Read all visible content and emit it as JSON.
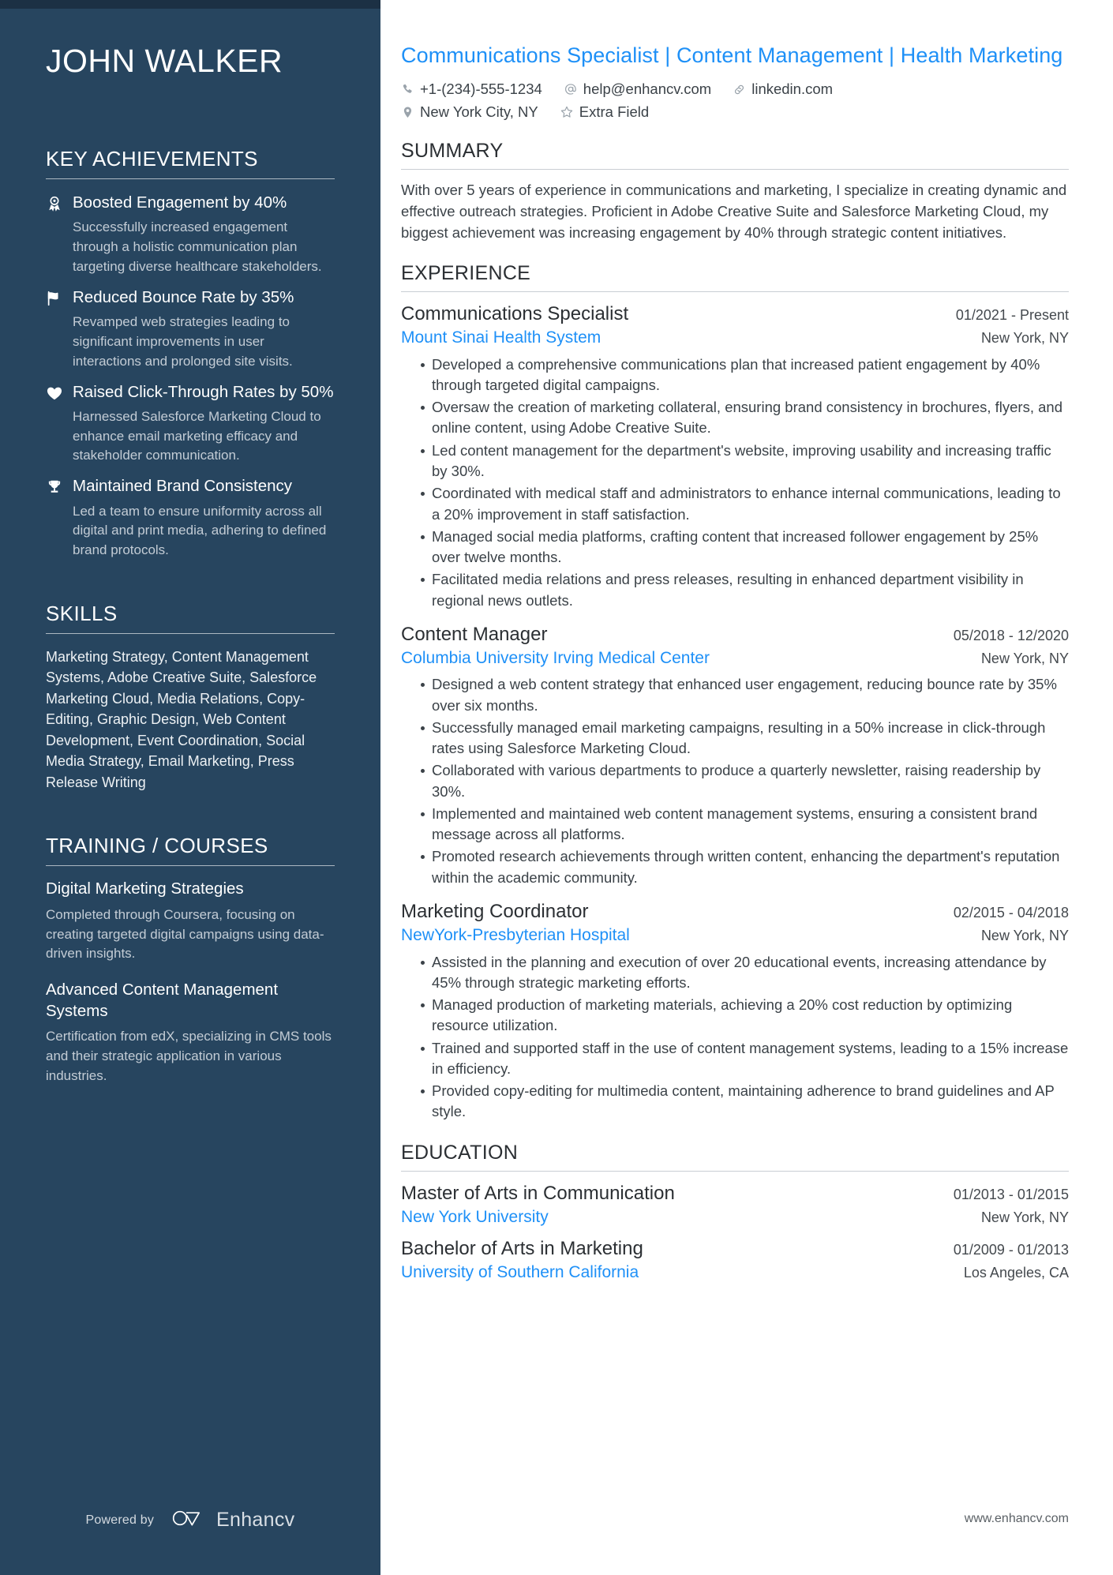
{
  "sidebar": {
    "name": "JOHN WALKER",
    "key_achievements_title": "KEY ACHIEVEMENTS",
    "achievements": [
      {
        "icon": "award-ribbon-icon",
        "title": "Boosted Engagement by 40%",
        "description": "Successfully increased engagement through a holistic communication plan targeting diverse healthcare stakeholders."
      },
      {
        "icon": "flag-icon",
        "title": "Reduced Bounce Rate by 35%",
        "description": "Revamped web strategies leading to significant improvements in user interactions and prolonged site visits."
      },
      {
        "icon": "heart-icon",
        "title": "Raised Click-Through Rates by 50%",
        "description": "Harnessed Salesforce Marketing Cloud to enhance email marketing efficacy and stakeholder communication."
      },
      {
        "icon": "trophy-icon",
        "title": "Maintained Brand Consistency",
        "description": "Led a team to ensure uniformity across all digital and print media, adhering to defined brand protocols."
      }
    ],
    "skills_title": "SKILLS",
    "skills_text": "Marketing Strategy, Content Management Systems, Adobe Creative Suite, Salesforce Marketing Cloud, Media Relations, Copy-Editing, Graphic Design, Web Content Development, Event Coordination, Social Media Strategy, Email Marketing, Press Release Writing",
    "training_title": "TRAINING / COURSES",
    "courses": [
      {
        "title": "Digital Marketing Strategies",
        "description": "Completed through Coursera, focusing on creating targeted digital campaigns using data-driven insights."
      },
      {
        "title": "Advanced Content Management Systems",
        "description": "Certification from edX, specializing in CMS tools and their strategic application in various industries."
      }
    ],
    "footer": {
      "powered_by": "Powered by",
      "brand": "Enhancv",
      "brand_icon": "enhancv-logo-icon"
    }
  },
  "main": {
    "headline": "Communications Specialist | Content Management | Health Marketing",
    "contact": {
      "row1": [
        {
          "icon": "phone-icon",
          "value": "+1-(234)-555-1234"
        },
        {
          "icon": "at-sign-icon",
          "value": "help@enhancv.com"
        },
        {
          "icon": "link-icon",
          "value": "linkedin.com"
        }
      ],
      "row2": [
        {
          "icon": "location-pin-icon",
          "value": "New York City, NY"
        },
        {
          "icon": "star-icon",
          "value": "Extra Field"
        }
      ]
    },
    "summary": {
      "title": "SUMMARY",
      "text": "With over 5 years of experience in communications and marketing, I specialize in creating dynamic and effective outreach strategies. Proficient in Adobe Creative Suite and Salesforce Marketing Cloud, my biggest achievement was increasing engagement by 40% through strategic content initiatives."
    },
    "experience": {
      "title": "EXPERIENCE",
      "entries": [
        {
          "role": "Communications Specialist",
          "date": "01/2021 - Present",
          "org": "Mount Sinai Health System",
          "location": "New York, NY",
          "bullets": [
            "Developed a comprehensive communications plan that increased patient engagement by 40% through targeted digital campaigns.",
            "Oversaw the creation of marketing collateral, ensuring brand consistency in brochures, flyers, and online content, using Adobe Creative Suite.",
            "Led content management for the department's website, improving usability and increasing traffic by 30%.",
            "Coordinated with medical staff and administrators to enhance internal communications, leading to a 20% improvement in staff satisfaction.",
            "Managed social media platforms, crafting content that increased follower engagement by 25% over twelve months.",
            "Facilitated media relations and press releases, resulting in enhanced department visibility in regional news outlets."
          ]
        },
        {
          "role": "Content Manager",
          "date": "05/2018 - 12/2020",
          "org": "Columbia University Irving Medical Center",
          "location": "New York, NY",
          "bullets": [
            "Designed a web content strategy that enhanced user engagement, reducing bounce rate by 35% over six months.",
            "Successfully managed email marketing campaigns, resulting in a 50% increase in click-through rates using Salesforce Marketing Cloud.",
            "Collaborated with various departments to produce a quarterly newsletter, raising readership by 30%.",
            "Implemented and maintained web content management systems, ensuring a consistent brand message across all platforms.",
            "Promoted research achievements through written content, enhancing the department's reputation within the academic community."
          ]
        },
        {
          "role": "Marketing Coordinator",
          "date": "02/2015 - 04/2018",
          "org": "NewYork-Presbyterian Hospital",
          "location": "New York, NY",
          "bullets": [
            "Assisted in the planning and execution of over 20 educational events, increasing attendance by 45% through strategic marketing efforts.",
            "Managed production of marketing materials, achieving a 20% cost reduction by optimizing resource utilization.",
            "Trained and supported staff in the use of content management systems, leading to a 15% increase in efficiency.",
            "Provided copy-editing for multimedia content, maintaining adherence to brand guidelines and AP style."
          ]
        }
      ]
    },
    "education": {
      "title": "EDUCATION",
      "entries": [
        {
          "degree": "Master of Arts in Communication",
          "date": "01/2013 - 01/2015",
          "school": "New York University",
          "location": "New York, NY"
        },
        {
          "degree": "Bachelor of Arts in Marketing",
          "date": "01/2009 - 01/2013",
          "school": "University of Southern California",
          "location": "Los Angeles, CA"
        }
      ]
    },
    "footer_url": "www.enhancv.com"
  },
  "colors": {
    "sidebar_bg": "#27455f",
    "sidebar_topbar": "#1c3044",
    "accent_blue": "#1e90f7",
    "body_text": "#3b4248"
  }
}
